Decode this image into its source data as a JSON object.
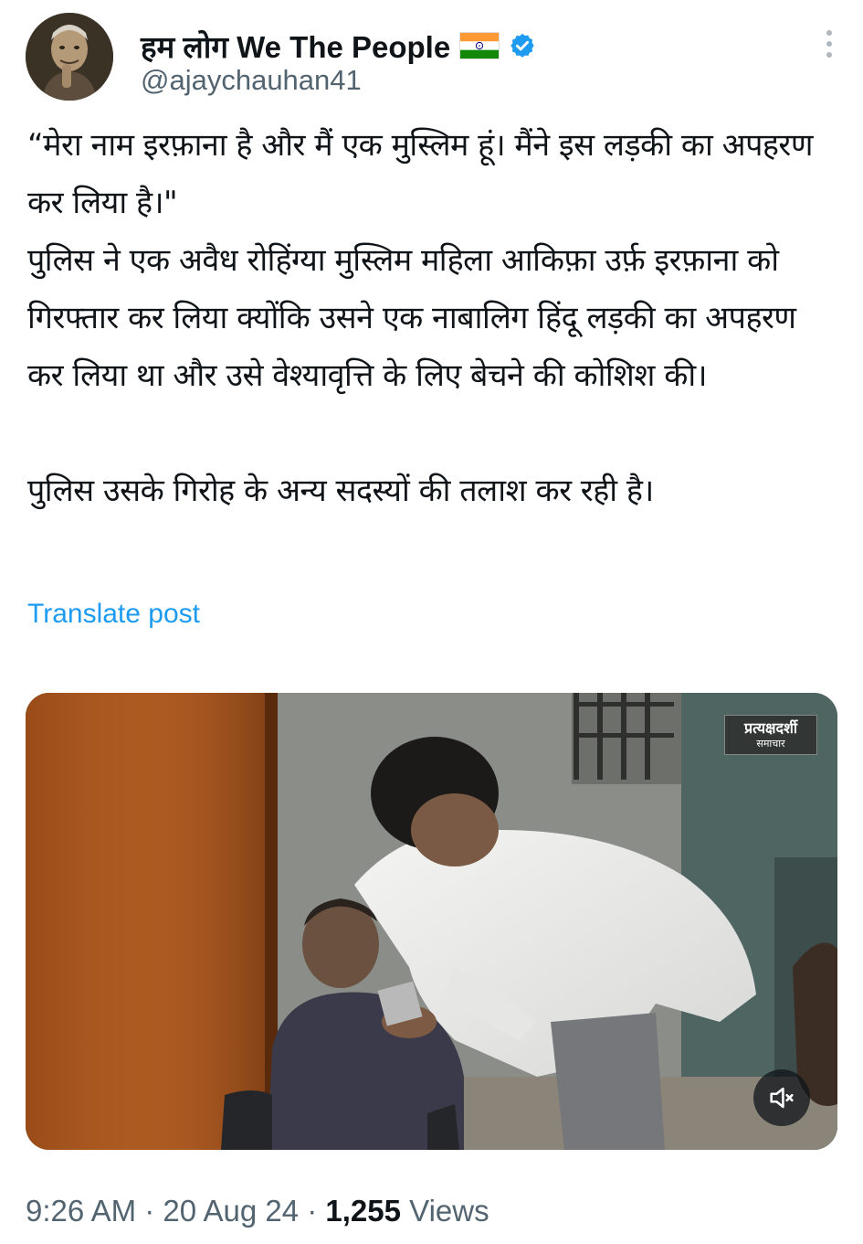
{
  "author": {
    "display_name": "हम लोग We The People",
    "handle": "@ajaychauhan41",
    "verified": true,
    "flag": "india-flag-icon"
  },
  "tweet": {
    "paragraph_1": "“मेरा नाम इरफ़ाना है और मैं एक मुस्लिम हूं। मैंने इस लड़की का अपहरण कर लिया है।\"",
    "paragraph_2": "पुलिस ने एक अवैध रोहिंग्या मुस्लिम महिला आकिफ़ा उर्फ़ इरफ़ाना को गिरफ्तार कर लिया क्योंकि उसने एक नाबालिग हिंदू लड़की का अपहरण कर लिया था और उसे वेश्यावृत्ति के लिए बेचने की कोशिश की।",
    "paragraph_3": "पुलिस उसके गिरोह के अन्य सदस्यों की तलाश कर रही है।",
    "translate_label": "Translate post"
  },
  "media": {
    "watermark_line1": "प्रत्यक्षदर्शी",
    "watermark_line2": "समाचार",
    "mute_icon": "speaker-muted-icon"
  },
  "meta": {
    "time": "9:26 AM",
    "separator": " · ",
    "date": "20 Aug 24",
    "views_count": "1,255",
    "views_label": " Views"
  },
  "colors": {
    "link": "#1d9bf0",
    "verified": "#1d9bf0",
    "secondary_text": "#536471",
    "primary_text": "#0f1419"
  }
}
